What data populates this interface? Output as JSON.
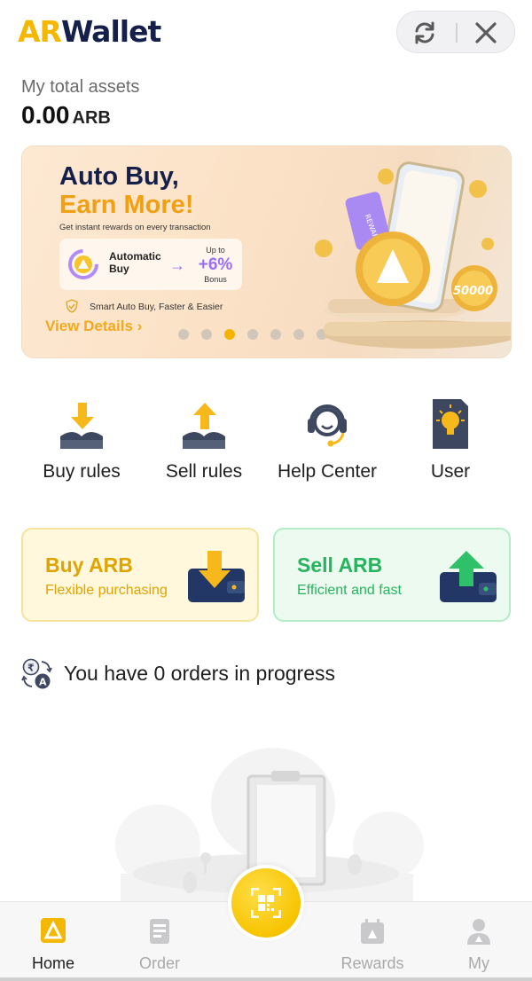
{
  "app": {
    "logo_ar": "AR",
    "logo_wallet": "Wallet",
    "brand_color": "#f5b800",
    "navy_color": "#15204a"
  },
  "assets": {
    "label": "My total assets",
    "value": "0.00",
    "unit": "ARB"
  },
  "banner": {
    "headline_line1": "Auto Buy,",
    "headline_line2": "Earn More!",
    "tagline": "Get instant rewards on every transaction",
    "auto_label": "Automatic Buy",
    "up_to": "Up to",
    "percent": "+6%",
    "bonus": "Bonus",
    "smart_text": "Smart Auto Buy, Faster & Easier",
    "view_details": "View Details",
    "coin_text": "50000",
    "ticket_text": "REWARD",
    "slide_count": 8,
    "active_slide": 3
  },
  "quick_actions": [
    {
      "label": "Buy rules",
      "icon": "buy-rules-icon"
    },
    {
      "label": "Sell rules",
      "icon": "sell-rules-icon"
    },
    {
      "label": "Help Center",
      "icon": "headset-icon"
    },
    {
      "label": "User",
      "icon": "user-lightbulb-icon"
    }
  ],
  "trade": {
    "buy_title": "Buy ARB",
    "buy_sub": "Flexible purchasing",
    "sell_title": "Sell ARB",
    "sell_sub": "Efficient and fast"
  },
  "orders": {
    "text": "You have 0 orders in progress"
  },
  "tabbar": {
    "tabs": [
      {
        "label": "Home",
        "icon": "home-icon",
        "active": true
      },
      {
        "label": "Order",
        "icon": "order-icon",
        "active": false
      },
      {
        "label": "Rewards",
        "icon": "rewards-icon",
        "active": false
      },
      {
        "label": "My",
        "icon": "profile-icon",
        "active": false
      }
    ],
    "center": "qr-scan-icon"
  }
}
